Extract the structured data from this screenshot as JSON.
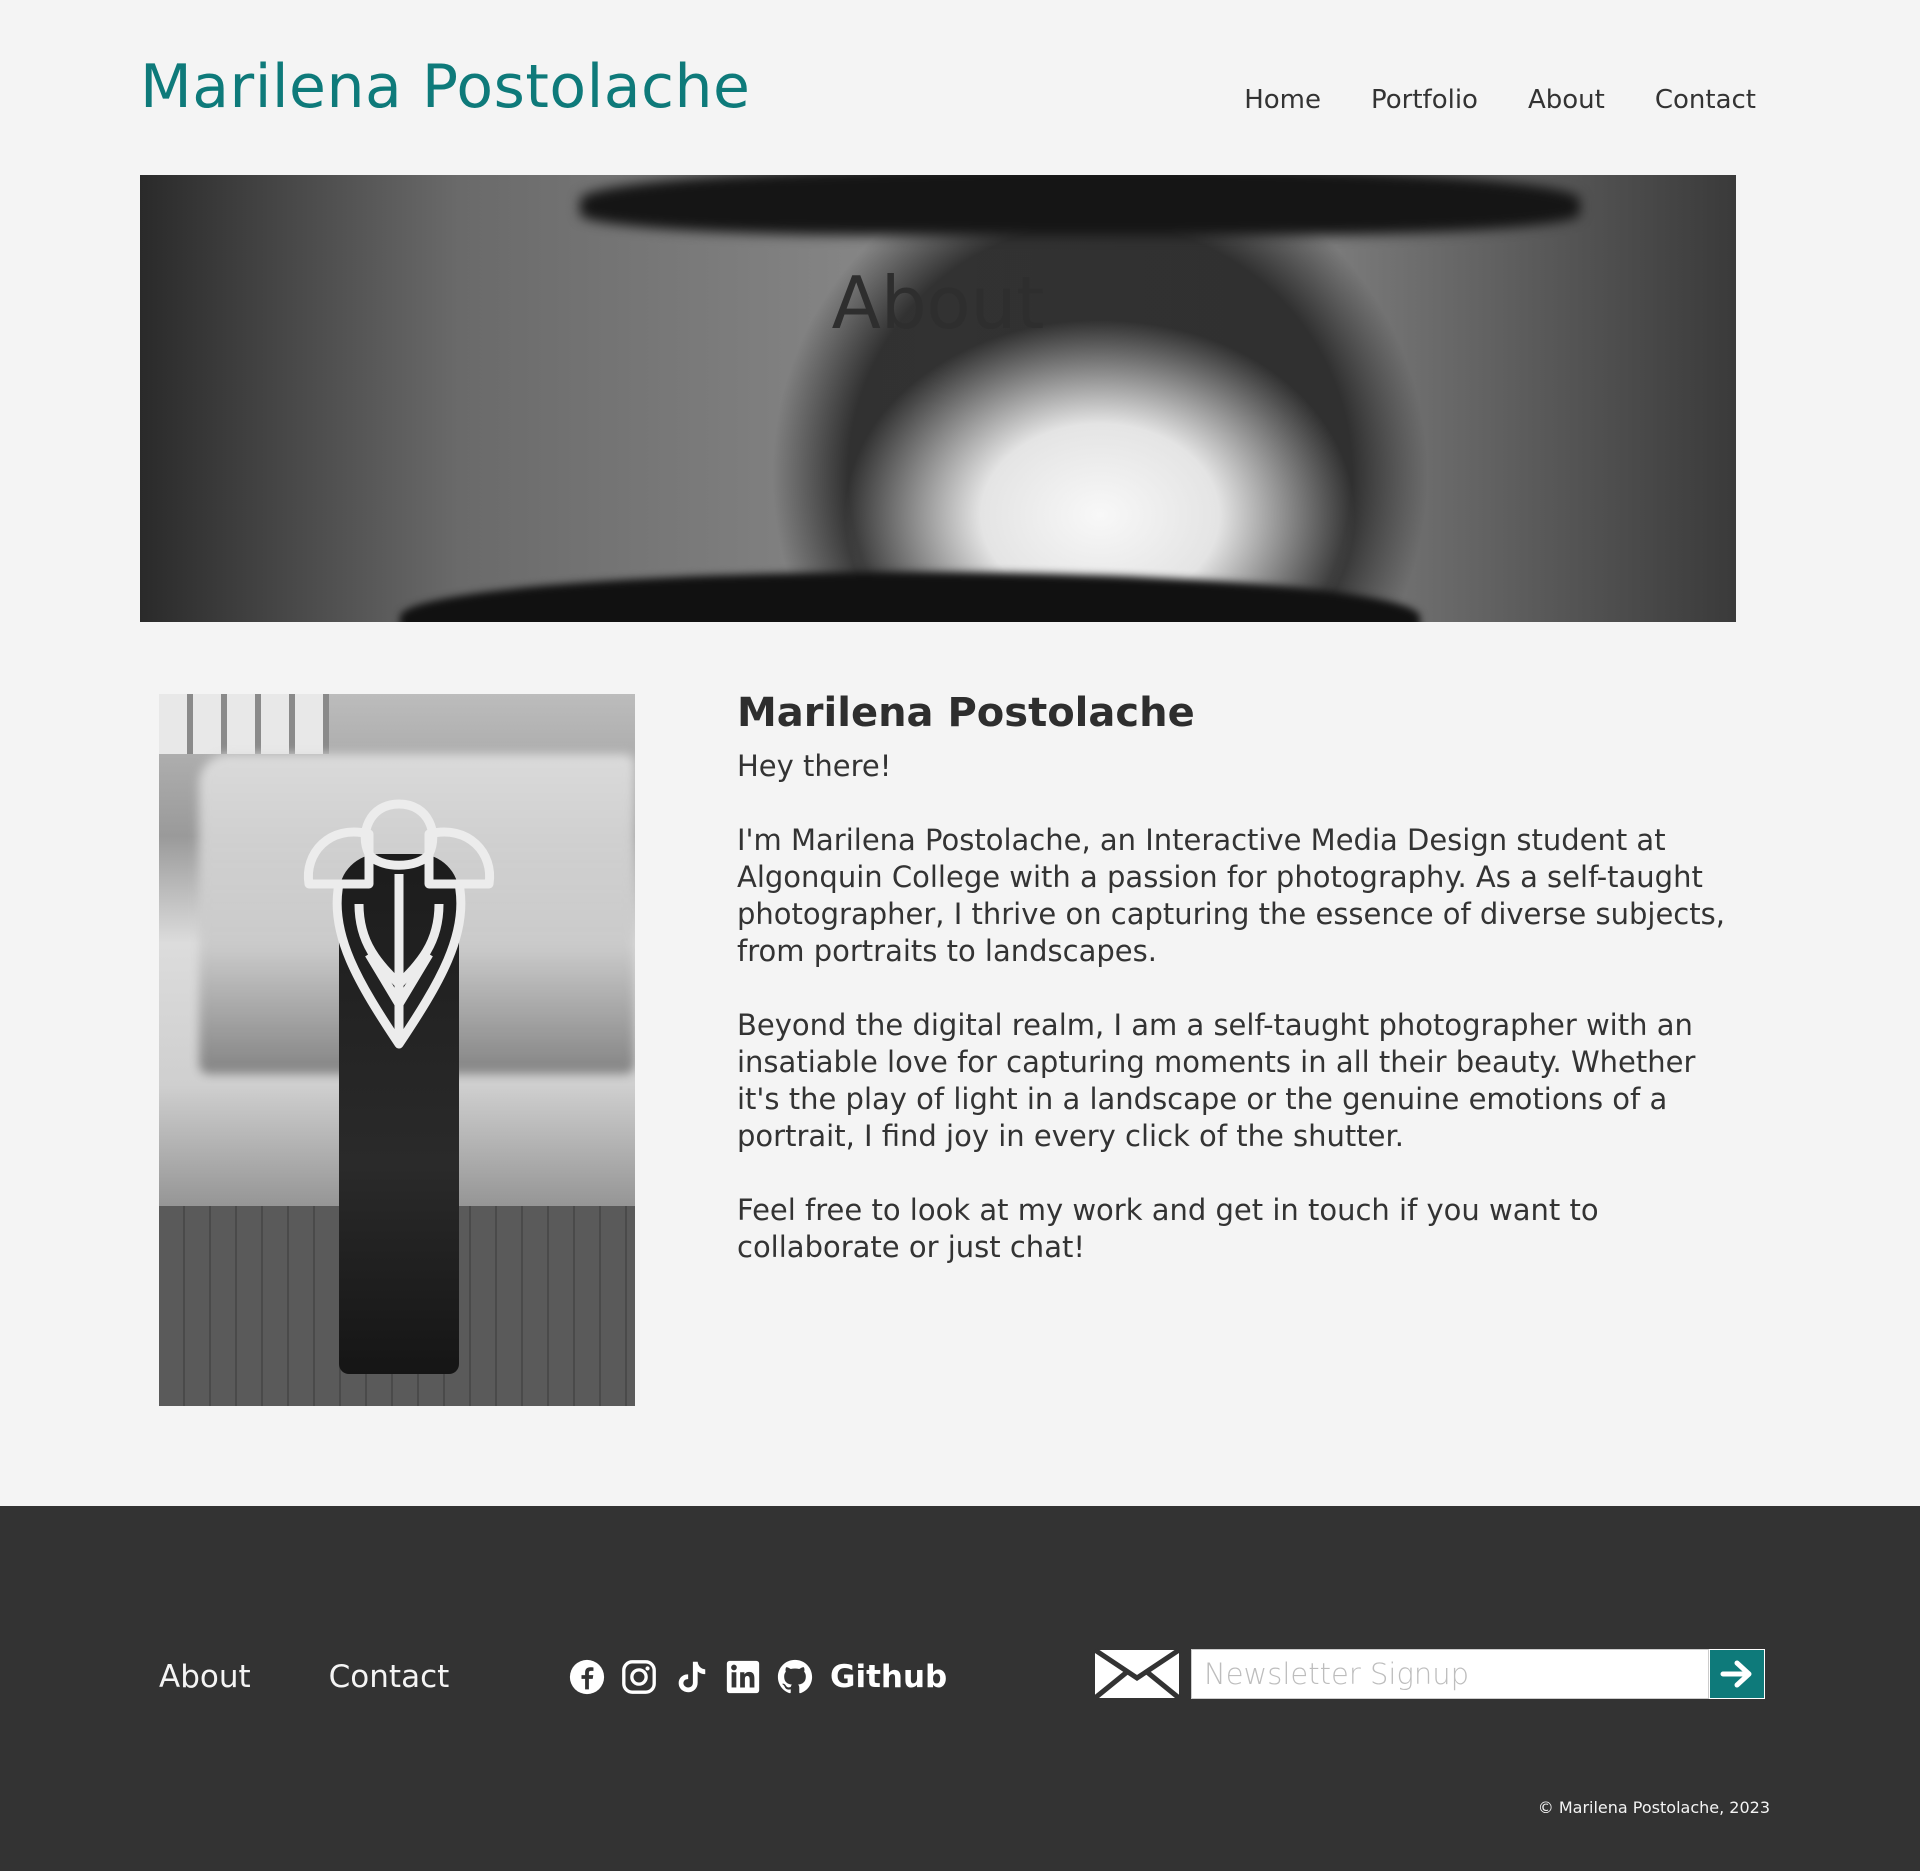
{
  "header": {
    "site_title": "Marilena Postolache",
    "nav": [
      {
        "label": "Home"
      },
      {
        "label": "Portfolio"
      },
      {
        "label": "About"
      },
      {
        "label": "Contact"
      }
    ]
  },
  "hero": {
    "title": "About"
  },
  "bio": {
    "name": "Marilena Postolache",
    "greeting": "Hey there!",
    "paragraphs": [
      "I'm Marilena Postolache, an Interactive Media Design student at Algonquin College with a passion for photography. As a self-taught photographer, I thrive on capturing the essence of diverse subjects, from portraits to landscapes.",
      "Beyond the digital realm, I am a self-taught photographer with an insatiable love for capturing moments in all their beauty. Whether it's the play of light in a landscape or the genuine emotions of a portrait, I find joy in every click of the shutter.",
      "Feel free to look at my work and get in touch if you want to collaborate or just chat!"
    ]
  },
  "footer": {
    "links": [
      {
        "label": "About"
      },
      {
        "label": "Contact"
      }
    ],
    "social": {
      "icons": [
        "facebook-icon",
        "instagram-icon",
        "tiktok-icon",
        "linkedin-icon",
        "github-icon"
      ],
      "github_label": "Github"
    },
    "newsletter": {
      "placeholder": "Newsletter Signup"
    },
    "copyright": "© Marilena Postolache, 2023"
  },
  "colors": {
    "accent": "#0e7a7a",
    "background": "#f4f4f4",
    "footer": "#333333",
    "text": "#333333"
  }
}
